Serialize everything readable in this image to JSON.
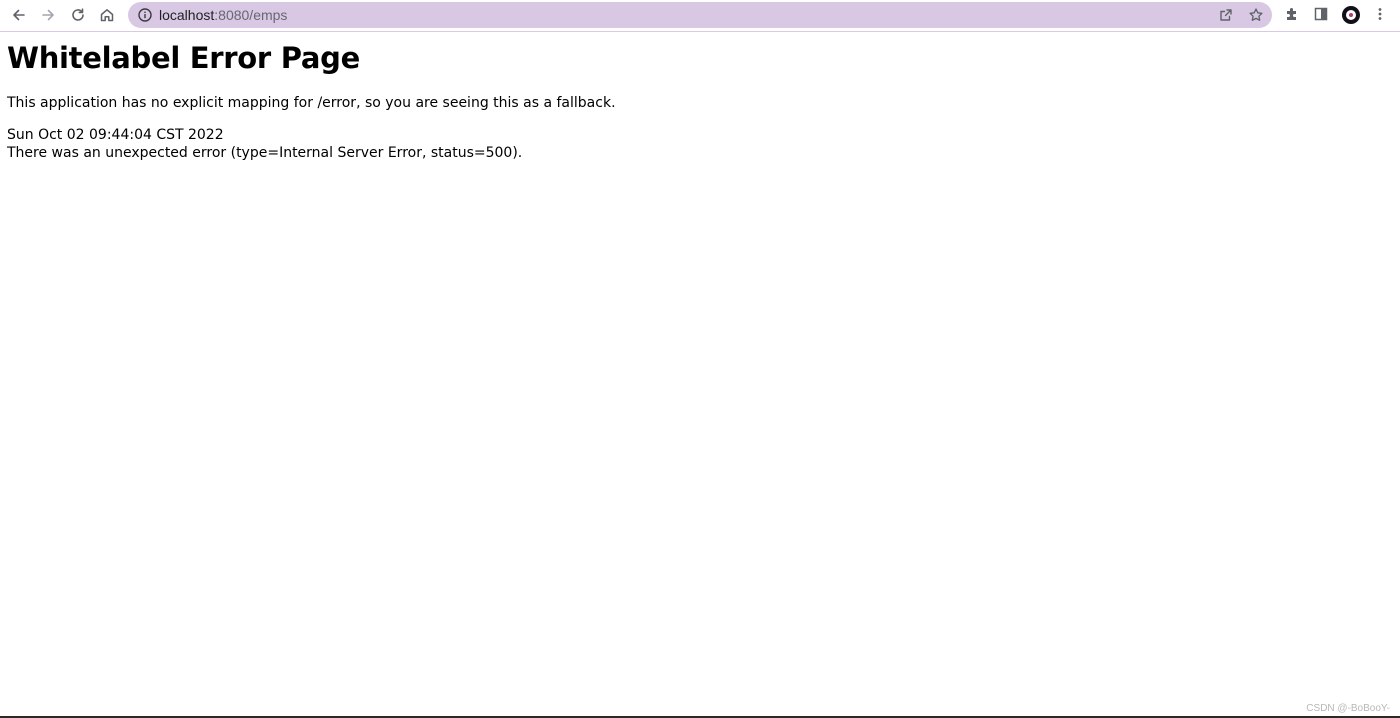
{
  "browser": {
    "url_host": "localhost",
    "url_rest": ":8080/emps",
    "back_icon": "arrow-left-icon",
    "forward_icon": "arrow-right-icon",
    "reload_icon": "reload-icon",
    "home_icon": "home-icon",
    "site_info_icon": "info-circle-icon",
    "share_icon": "share-icon",
    "bookmark_icon": "star-icon",
    "extensions_icon": "puzzle-icon",
    "side_panel_icon": "side-panel-icon",
    "menu_icon": "kebab-menu-icon",
    "accent_color": "#d8c8e4"
  },
  "page": {
    "title": "Whitelabel Error Page",
    "fallback_message": "This application has no explicit mapping for /error, so you are seeing this as a fallback.",
    "timestamp": "Sun Oct 02 09:44:04 CST 2022",
    "error_message": "There was an unexpected error (type=Internal Server Error, status=500)."
  },
  "watermark": "CSDN @-BoBooY-"
}
